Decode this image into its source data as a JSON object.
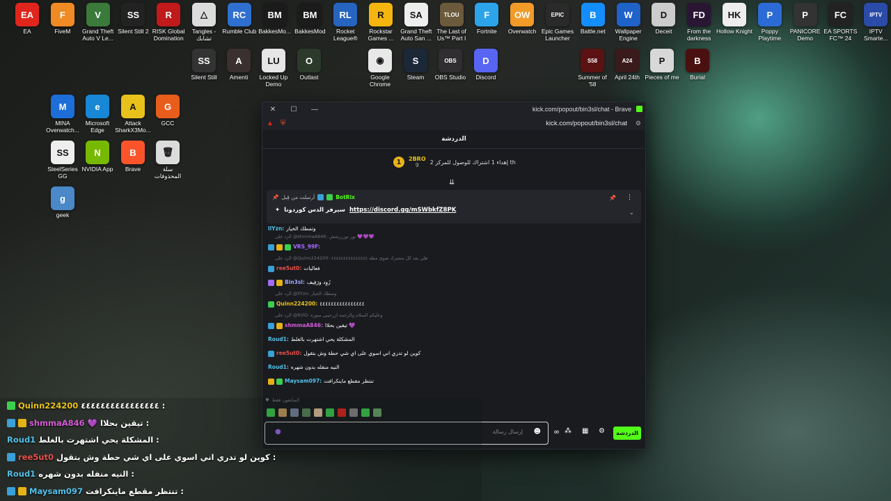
{
  "desktop": {
    "row1": [
      {
        "label": "EA",
        "color": "#e0261c",
        "glyph": "EA",
        "icon": "ea-icon"
      },
      {
        "label": "FiveM",
        "color": "#f08a24",
        "glyph": "F",
        "icon": "fivem-icon"
      },
      {
        "label": "Grand Theft Auto V Le...",
        "color": "#3a7a3a",
        "glyph": "V",
        "icon": "gta-v-icon"
      },
      {
        "label": "Silent Still 2",
        "color": "#222",
        "glyph": "SS",
        "icon": "silent-still-2-icon"
      },
      {
        "label": "RISK Global Domination",
        "color": "#c01a1a",
        "glyph": "R",
        "icon": "risk-icon"
      },
      {
        "label": "Tangles - تشابك",
        "color": "#dcdcdc",
        "glyph": "△",
        "icon": "tangles-icon"
      },
      {
        "label": "Rumble Club",
        "color": "#2f6fd0",
        "glyph": "RC",
        "icon": "rumble-club-icon"
      },
      {
        "label": "BakkesMo...",
        "color": "#1b1b1b",
        "glyph": "BM",
        "icon": "bakkesmod-icon"
      },
      {
        "label": "BakkesMod",
        "color": "#1b1b1b",
        "glyph": "BM",
        "icon": "bakkesmod2-icon"
      },
      {
        "label": "Rocket League®",
        "color": "#2764c0",
        "glyph": "RL",
        "icon": "rocket-league-icon"
      },
      {
        "label": "Rockstar Games ...",
        "color": "#f5b50f",
        "glyph": "R",
        "icon": "rockstar-icon"
      },
      {
        "label": "Grand Theft Auto San ...",
        "color": "#eee",
        "glyph": "SA",
        "icon": "gta-sa-icon"
      },
      {
        "label": "The Last of Us™ Part I",
        "color": "#6b5a3c",
        "glyph": "TLOU",
        "icon": "tlou-icon"
      },
      {
        "label": "Fortnite",
        "color": "#2da4ea",
        "glyph": "F",
        "icon": "fortnite-icon"
      },
      {
        "label": "Overwatch",
        "color": "#f29b28",
        "glyph": "OW",
        "icon": "overwatch-icon"
      },
      {
        "label": "Epic Games Launcher",
        "color": "#2a2a2a",
        "glyph": "EPIC",
        "icon": "epic-games-icon"
      },
      {
        "label": "Battle.net",
        "color": "#148eff",
        "glyph": "B",
        "icon": "battlenet-icon"
      },
      {
        "label": "Wallpaper Engine",
        "color": "#1f62c8",
        "glyph": "W",
        "icon": "wallpaper-engine-icon"
      },
      {
        "label": "Deceit",
        "color": "#ccc",
        "glyph": "D",
        "icon": "deceit-icon"
      },
      {
        "label": "From the darkness",
        "color": "#2a1633",
        "glyph": "FD",
        "icon": "from-darkness-icon"
      },
      {
        "label": "Hollow Knight",
        "color": "#eee",
        "glyph": "HK",
        "icon": "hollow-knight-icon"
      },
      {
        "label": "Poppy Playtime",
        "color": "#2c6bd6",
        "glyph": "P",
        "icon": "poppy-icon"
      },
      {
        "label": "PANICORE Demo",
        "color": "#333",
        "glyph": "P",
        "icon": "panicore-icon"
      },
      {
        "label": "EA SPORTS FC™ 24",
        "color": "#222",
        "glyph": "FC",
        "icon": "fc24-icon"
      },
      {
        "label": "IPTV Smarte...",
        "color": "#2b4ba8",
        "glyph": "IPTV",
        "icon": "iptv-icon"
      }
    ],
    "row2": [
      {
        "label": "Silent Still",
        "color": "#333",
        "glyph": "SS",
        "icon": "silent-still-icon"
      },
      {
        "label": "Amenti",
        "color": "#3a3030",
        "glyph": "A",
        "icon": "amenti-icon"
      },
      {
        "label": "Locked Up Demo",
        "color": "#e6e6e6",
        "glyph": "LU",
        "icon": "locked-up-icon"
      },
      {
        "label": "Outlast",
        "color": "#2b3a2b",
        "glyph": "O",
        "icon": "outlast-icon"
      },
      {
        "label": "Google Chrome",
        "color": "#e8e8e8",
        "glyph": "◉",
        "icon": "chrome-icon"
      },
      {
        "label": "Steam",
        "color": "#1b2838",
        "glyph": "S",
        "icon": "steam-icon"
      },
      {
        "label": "OBS Studio",
        "color": "#302e31",
        "glyph": "OBS",
        "icon": "obs-icon"
      },
      {
        "label": "Discord",
        "color": "#5865f2",
        "glyph": "D",
        "icon": "discord-icon"
      },
      {
        "label": "Summer of '58",
        "color": "#5a1212",
        "glyph": "S58",
        "icon": "summer58-icon"
      },
      {
        "label": "April 24th",
        "color": "#3a1a1a",
        "glyph": "A24",
        "icon": "april24-icon"
      },
      {
        "label": "Pieces of me",
        "color": "#d8d8d8",
        "glyph": "P",
        "icon": "pieces-icon"
      },
      {
        "label": "Burial",
        "color": "#4a1010",
        "glyph": "B",
        "icon": "burial-icon"
      }
    ],
    "col": [
      {
        "label": "MINA Overwatch...",
        "color": "#1d6ed8",
        "glyph": "M",
        "icon": "mina-icon"
      },
      {
        "label": "Microsoft Edge",
        "color": "#1787d6",
        "glyph": "e",
        "icon": "edge-icon"
      },
      {
        "label": "Attack SharkX3Mo...",
        "color": "#e8c21a",
        "glyph": "A",
        "icon": "attack-shark-icon"
      },
      {
        "label": "GCC",
        "color": "#e85d1c",
        "glyph": "G",
        "icon": "gcc-icon"
      },
      {
        "label": "SteelSeries GG",
        "color": "#eee",
        "glyph": "SS",
        "icon": "steelseries-icon"
      },
      {
        "label": "NVIDIA App",
        "color": "#76b900",
        "glyph": "N",
        "icon": "nvidia-icon"
      },
      {
        "label": "Brave",
        "color": "#fb542b",
        "glyph": "B",
        "icon": "brave-icon"
      },
      {
        "label": "سلة المحذوفات",
        "color": "#dcdcdc",
        "glyph": "🗑",
        "icon": "recycle-bin-icon"
      },
      {
        "label": "geek",
        "color": "#4a88c8",
        "glyph": "g",
        "icon": "geek-icon"
      }
    ]
  },
  "window": {
    "title": "kick.com/popout/bin3sl/chat - Brave",
    "url": "kick.com/popout/bin3sl/chat",
    "close": "✕",
    "maximize": "☐",
    "minimize": "—"
  },
  "chat": {
    "header": "الدردشة",
    "goal": {
      "user": "2BRO",
      "count": "9",
      "text": "إهداء 1 اشتراك للوصول للمركز 2 th"
    },
    "pinned": {
      "pinned_by": "أرسلت من قِبل",
      "author": "BotRix",
      "link": "https://discord.gg/mSWbkfZ8PK",
      "text": "سيرفر الدس كوردونا"
    },
    "messages": [
      {
        "type": "plain",
        "user": "llYzn",
        "text": "وتمطك الخيار",
        "ucolor": "#53c1e8"
      },
      {
        "type": "reply",
        "text": "الرد على @shmmaA846: نور نورررشش 💜💜💜"
      },
      {
        "type": "msg",
        "user": "VRS_99F",
        "text": "",
        "ucolor": "#a66bff",
        "badges": [
          "b-blue",
          "b-gold",
          "b-green"
        ]
      },
      {
        "type": "reply",
        "text": "الرد على @Quinn224200: هلي بعد كل مشترك ضوي مطه ٤٤٤٤٤٤٤٤٤٤٤٤٤٤٤"
      },
      {
        "type": "msg",
        "user": "ree5ut0",
        "text": "فعاليات",
        "ucolor": "#e8504a",
        "badges": [
          "b-blue"
        ]
      },
      {
        "type": "msg",
        "user": "Bin3sl",
        "text": "رُوِد ورَفِيف",
        "ucolor": "#9fa6ff",
        "badges": [
          "b-purple",
          "b-gold"
        ]
      },
      {
        "type": "reply",
        "text": "الرد على @llYzn: وتمطك الخيار"
      },
      {
        "type": "msg",
        "user": "Quinn224200",
        "text": "٤٤٤٤٤٤٤٤٤٤٤٤٤٤٤٤",
        "ucolor": "#e8c21a",
        "badges": [
          "b-green"
        ]
      },
      {
        "type": "reply",
        "text": "الرد على @lhilO: وعليكم السلام والرحمه ازرحيبي منوره"
      },
      {
        "type": "msg",
        "user": "shmmaA846",
        "text": "تيقين بحلاا 💜",
        "ucolor": "#d45ad6",
        "badges": [
          "b-blue",
          "b-gold"
        ]
      },
      {
        "type": "msg",
        "user": "Roud1",
        "text": "المشكلة يحي اشتهرت بالغلط",
        "ucolor": "#53c1e8",
        "badges": []
      },
      {
        "type": "msg",
        "user": "ree5ut0",
        "text": "كوين لو تدري اني اسوي على اي شي حطة وش بتقول",
        "ucolor": "#e8504a",
        "badges": [
          "b-blue"
        ]
      },
      {
        "type": "msg",
        "user": "Roud1",
        "text": "النيه منفله بدون شهره",
        "ucolor": "#53c1e8",
        "badges": []
      },
      {
        "type": "msg",
        "user": "Maysam097",
        "text": "تنتظر مقطع ماينكرافت",
        "ucolor": "#53c1e8",
        "badges": [
          "b-gold",
          "b-green"
        ]
      }
    ],
    "followers_only": "المتابعون فقط",
    "input_placeholder": "إرسال رسالة",
    "send_label": "الدردشة"
  },
  "overlay": {
    "lines": [
      {
        "user": "Quinn224200",
        "text": "٤٤٤٤٤٤٤٤٤٤٤٤٤٤٤٤ :",
        "ucolor": "#e8c21a",
        "badges": [
          "b-green"
        ]
      },
      {
        "user": "shmmaA846",
        "text": "💜 تيقين بحلاا :",
        "ucolor": "#d45ad6",
        "badges": [
          "b-blue",
          "b-gold"
        ]
      },
      {
        "user": "Roud1",
        "text": "المشكلة يحي اشتهرت بالغلط :",
        "ucolor": "#53c1e8",
        "badges": []
      },
      {
        "user": "ree5ut0",
        "text": "كوين لو تدري اني اسوي على اي شي حطة وش بتقول :",
        "ucolor": "#e8504a",
        "badges": [
          "b-blue"
        ]
      },
      {
        "user": "Roud1",
        "text": "النيه منفله بدون شهره :",
        "ucolor": "#53c1e8",
        "badges": []
      },
      {
        "user": "Maysam097",
        "text": "تنتظر مقطع ماينكرافت :",
        "ucolor": "#53c1e8",
        "badges": [
          "b-blue",
          "b-gold"
        ]
      }
    ]
  }
}
